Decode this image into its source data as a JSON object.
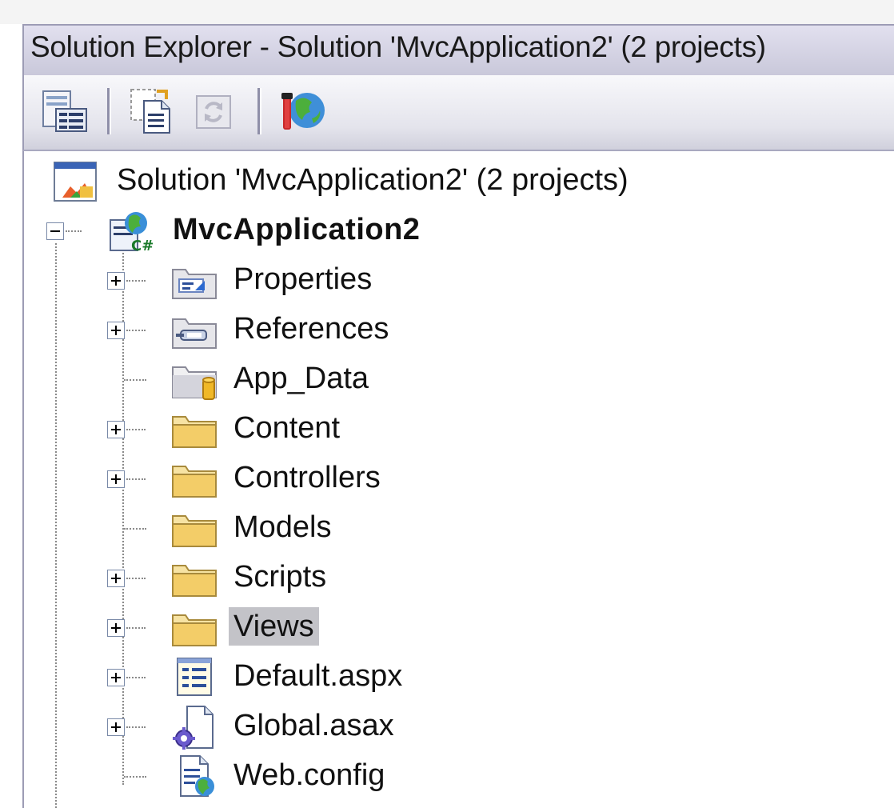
{
  "window": {
    "title": "Solution Explorer - Solution 'MvcApplication2' (2 projects)"
  },
  "toolbar": {
    "buttons": [
      {
        "name": "properties-button",
        "icon": "properties-icon"
      },
      {
        "name": "show-all-files-button",
        "icon": "show-all-files-icon"
      },
      {
        "name": "refresh-button",
        "icon": "refresh-icon",
        "disabled": true
      },
      {
        "name": "asp-net-configuration-button",
        "icon": "asp-net-configuration-icon"
      }
    ]
  },
  "tree": {
    "solution": {
      "label": "Solution 'MvcApplication2' (2 projects)",
      "icon": "solution-icon"
    },
    "project": {
      "label": "MvcApplication2",
      "icon": "csharp-web-project-icon",
      "expanded": true
    },
    "items": [
      {
        "label": "Properties",
        "icon": "properties-folder-icon",
        "expandable": true
      },
      {
        "label": "References",
        "icon": "references-folder-icon",
        "expandable": true
      },
      {
        "label": "App_Data",
        "icon": "app-data-folder-icon",
        "expandable": false
      },
      {
        "label": "Content",
        "icon": "folder-icon",
        "expandable": true
      },
      {
        "label": "Controllers",
        "icon": "folder-icon",
        "expandable": true
      },
      {
        "label": "Models",
        "icon": "folder-icon",
        "expandable": false
      },
      {
        "label": "Scripts",
        "icon": "folder-icon",
        "expandable": true
      },
      {
        "label": "Views",
        "icon": "folder-icon",
        "expandable": true,
        "selected": true
      },
      {
        "label": "Default.aspx",
        "icon": "aspx-file-icon",
        "expandable": true
      },
      {
        "label": "Global.asax",
        "icon": "asax-file-icon",
        "expandable": true
      },
      {
        "label": "Web.config",
        "icon": "config-file-icon",
        "expandable": false
      }
    ]
  },
  "colors": {
    "titlebar": "#c9c8da",
    "selection": "#c3c3c8",
    "folder": "#f3d27a"
  }
}
